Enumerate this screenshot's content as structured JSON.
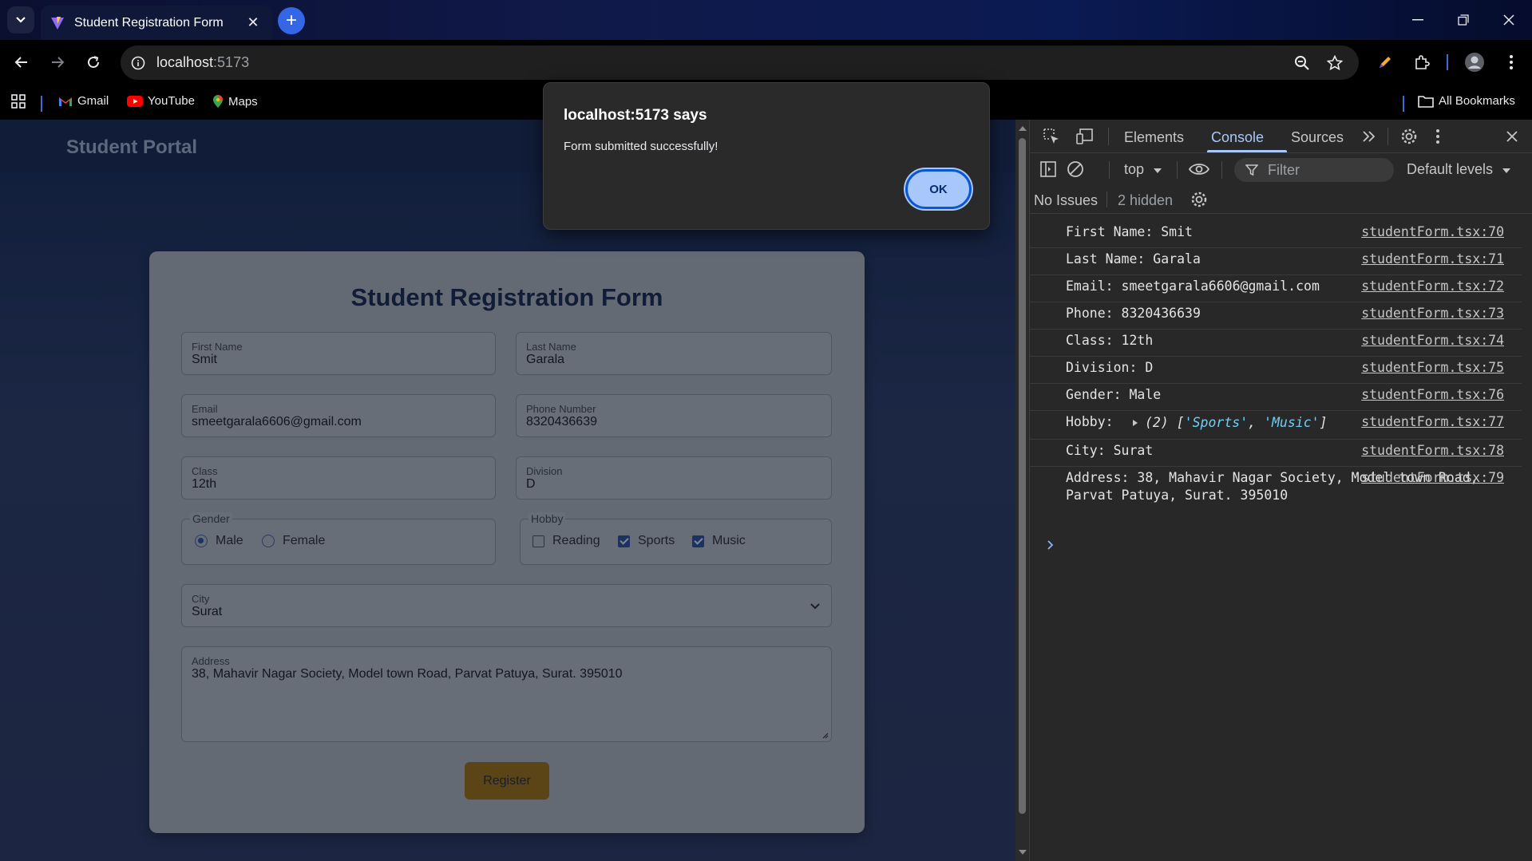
{
  "browser": {
    "tab_title": "Student Registration Form",
    "url_host": "localhost",
    "url_port": ":5173",
    "bookmarks": [
      "Gmail",
      "YouTube",
      "Maps"
    ],
    "all_bookmarks": "All Bookmarks"
  },
  "page": {
    "brand": "Student Portal",
    "form": {
      "title": "Student Registration Form",
      "first_name": {
        "label": "First Name",
        "value": "Smit"
      },
      "last_name": {
        "label": "Last Name",
        "value": "Garala"
      },
      "email": {
        "label": "Email",
        "value": "smeetgarala6606@gmail.com"
      },
      "phone": {
        "label": "Phone Number",
        "value": "8320436639"
      },
      "class": {
        "label": "Class",
        "value": "12th"
      },
      "division": {
        "label": "Division",
        "value": "D"
      },
      "gender": {
        "legend": "Gender",
        "options": [
          "Male",
          "Female"
        ],
        "selected": "Male"
      },
      "hobby": {
        "legend": "Hobby",
        "options": [
          "Reading",
          "Sports",
          "Music"
        ],
        "checked": [
          "Sports",
          "Music"
        ]
      },
      "city": {
        "label": "City",
        "value": "Surat"
      },
      "address": {
        "label": "Address",
        "value": "38, Mahavir Nagar Society, Model town Road, Parvat Patuya, Surat. 395010"
      },
      "register_label": "Register"
    }
  },
  "dialog": {
    "title": "localhost:5173 says",
    "message": "Form submitted successfully!",
    "ok_label": "OK"
  },
  "devtools": {
    "tabs": [
      "Elements",
      "Console",
      "Sources"
    ],
    "active_tab": "Console",
    "context": "top",
    "filter_placeholder": "Filter",
    "levels": "Default levels",
    "no_issues": "No Issues",
    "hidden": "2 hidden",
    "logs": [
      {
        "msg": "First Name: Smit",
        "src": "studentForm.tsx:70"
      },
      {
        "msg": "Last Name: Garala",
        "src": "studentForm.tsx:71"
      },
      {
        "msg": "Email: smeetgarala6606@gmail.com",
        "src": "studentForm.tsx:72"
      },
      {
        "msg": "Phone: 8320436639",
        "src": "studentForm.tsx:73"
      },
      {
        "msg": "Class: 12th",
        "src": "studentForm.tsx:74"
      },
      {
        "msg": "Division: D",
        "src": "studentForm.tsx:75"
      },
      {
        "msg": "Gender: Male",
        "src": "studentForm.tsx:76"
      },
      {
        "msg": "Hobby:",
        "src": "studentForm.tsx:77",
        "array_prefix": "(2) [",
        "array_items": [
          "'Sports'",
          "'Music'"
        ],
        "array_suffix": "]"
      },
      {
        "msg": "City: Surat",
        "src": "studentForm.tsx:78"
      },
      {
        "msg": "Address: 38, Mahavir Nagar Society, Model town Road, Parvat Patuya, Surat. 395010",
        "src": "studentForm.tsx:79"
      }
    ]
  },
  "colors": {
    "accent": "#a8c7fa",
    "register_bg": "#8d6a22",
    "form_title": "#1b2d55"
  }
}
